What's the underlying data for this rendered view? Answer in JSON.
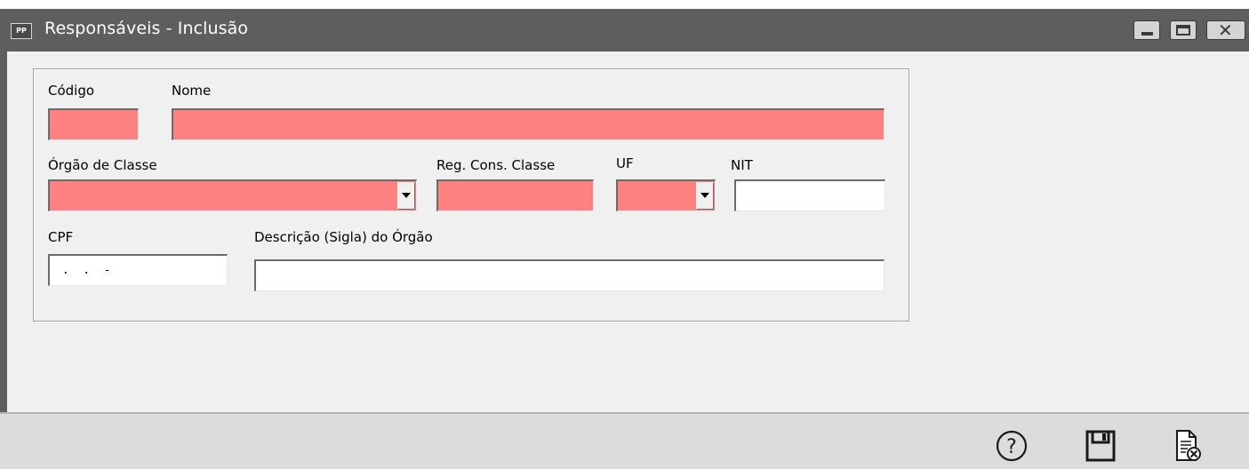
{
  "window": {
    "app_icon_text": "PP",
    "title": "Responsáveis - Inclusão",
    "controls": [
      "minimize",
      "maximize",
      "close"
    ]
  },
  "form": {
    "codigo": {
      "label": "Código",
      "value": ""
    },
    "nome": {
      "label": "Nome",
      "value": ""
    },
    "orgao_classe": {
      "label": "Órgão de Classe",
      "selected": ""
    },
    "reg_cons_classe": {
      "label": "Reg. Cons. Classe",
      "value": ""
    },
    "uf": {
      "label": "UF",
      "selected": ""
    },
    "nit": {
      "label": "NIT",
      "value": ""
    },
    "cpf": {
      "label": "CPF",
      "mask_value": " .  .  -"
    },
    "descricao_orgao": {
      "label": "Descrição (Sigla) do Órgão",
      "value": ""
    }
  },
  "toolbar": {
    "icons": [
      "help-icon",
      "save-icon",
      "cancel-document-icon"
    ]
  },
  "colors": {
    "required_field": "#ff8282",
    "titlebar": "#5e5e5e",
    "window_bg": "#f0f0f0"
  }
}
